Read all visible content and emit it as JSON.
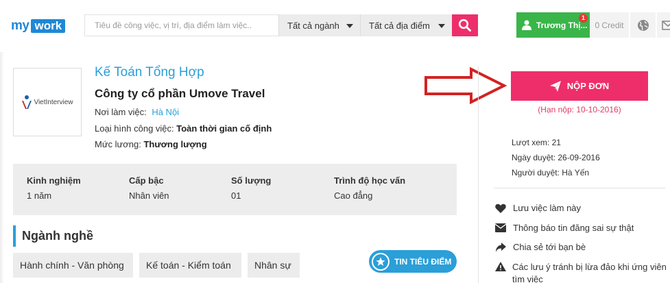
{
  "header": {
    "logo_my": "my",
    "logo_work": "work",
    "search_placeholder": "Tiêu đề công việc, vị trí, địa điểm làm việc..",
    "industry_select": "Tất cả ngành",
    "location_select": "Tất cả địa điểm",
    "user_name": "Trương Thị...",
    "notification_count": "1",
    "credit": "0 Credit",
    "accent_color": "#ee2e6b",
    "brand_color": "#1e88d6"
  },
  "job": {
    "title": "Kế Toán Tổng Hợp",
    "company": "Công ty cổ phần Umove Travel",
    "logo_text": "VietInterview",
    "workplace_label": "Nơi làm việc:",
    "workplace": "Hà Nội",
    "type_label": "Loại hình công việc:",
    "type": "Toàn thời gian cố định",
    "salary_label": "Mức lương:",
    "salary": "Thương lượng"
  },
  "stats": [
    {
      "label": "Kinh nghiệm",
      "value": "1 năm"
    },
    {
      "label": "Cấp bậc",
      "value": "Nhân viên"
    },
    {
      "label": "Số lượng",
      "value": "01"
    },
    {
      "label": "Trình độ học vấn",
      "value": "Cao đẳng"
    }
  ],
  "category": {
    "title": "Ngành nghề",
    "tags": [
      "Hành chính - Văn phòng",
      "Kế toán - Kiểm toán",
      "Nhân sự"
    ],
    "featured_label": "TIN TIÊU ĐIỂM"
  },
  "sidebar": {
    "apply_label": "NỘP ĐƠN",
    "deadline": "(Hạn nộp: 10-10-2016)",
    "views": "Lượt xem: 21",
    "approved_date": "Ngày duyệt: 26-09-2016",
    "approver": "Người duyệt: Hà Yến",
    "actions": [
      {
        "icon": "heart-icon",
        "label": "Lưu việc làm này"
      },
      {
        "icon": "envelope-icon",
        "label": "Thông báo tin đăng sai sự thật"
      },
      {
        "icon": "share-icon",
        "label": "Chia sẻ tới bạn bè"
      },
      {
        "icon": "warning-icon",
        "label": "Các lưu ý tránh bị lừa đảo khi ứng viên tìm việc"
      }
    ]
  }
}
